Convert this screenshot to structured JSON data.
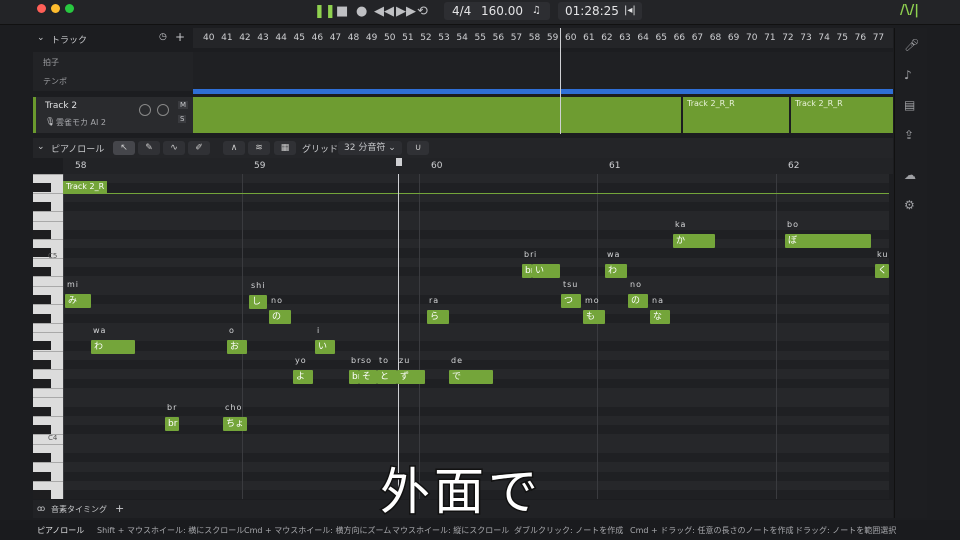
{
  "transport": {
    "time_sig": "4/4",
    "tempo": "160.00",
    "time": "01:28:25"
  },
  "colors": {
    "accent": "#74a53a",
    "clip": "#6e9c31",
    "playhead": "#cfd0d3"
  },
  "tracks_panel": {
    "title": "トラック",
    "rows": [
      "拍子",
      "テンポ"
    ]
  },
  "ruler_top": [
    "40",
    "41",
    "42",
    "43",
    "44",
    "45",
    "46",
    "47",
    "48",
    "49",
    "50",
    "51",
    "52",
    "53",
    "54",
    "55",
    "56",
    "57",
    "58",
    "59",
    "60",
    "61",
    "62",
    "63",
    "64",
    "65",
    "66",
    "67",
    "68",
    "69",
    "70",
    "71",
    "72",
    "73",
    "74",
    "75",
    "76",
    "77"
  ],
  "track2": {
    "name": "Track 2",
    "singer": "雲雀モカ AI 2",
    "mute": "M",
    "solo": "S"
  },
  "clips": [
    "Track 2_R_R",
    "Track 2_R_R"
  ],
  "piano_roll": {
    "title": "ピアノロール",
    "grid_label": "グリッド",
    "grid_value": "32 分音符",
    "bars": [
      "58",
      "59",
      "60",
      "61",
      "62"
    ],
    "clip_label": "Track 2_R",
    "key_c5": "C5",
    "key_c4": "C4"
  },
  "notes": [
    {
      "lyric": "み",
      "roman": "mi"
    },
    {
      "lyric": "わ",
      "roman": "wa"
    },
    {
      "lyric": "ちょ",
      "roman": "cho"
    },
    {
      "lyric": "br",
      "roman": "br"
    },
    {
      "lyric": "お",
      "roman": "o"
    },
    {
      "lyric": "し",
      "roman": "shi"
    },
    {
      "lyric": "の",
      "roman": "no"
    },
    {
      "lyric": "よ",
      "roman": "yo"
    },
    {
      "lyric": "い",
      "roman": "i"
    },
    {
      "lyric": "br",
      "roman": "br"
    },
    {
      "lyric": "そ",
      "roman": "so"
    },
    {
      "lyric": "と",
      "roman": "to"
    },
    {
      "lyric": "ず",
      "roman": "zu"
    },
    {
      "lyric": "ら",
      "roman": "ra"
    },
    {
      "lyric": "で",
      "roman": "de"
    },
    {
      "lyric": "br",
      "roman": "br"
    },
    {
      "lyric": "い",
      "roman": "i"
    },
    {
      "lyric": "つ",
      "roman": "tsu"
    },
    {
      "lyric": "も",
      "roman": "mo"
    },
    {
      "lyric": "わ",
      "roman": "wa"
    },
    {
      "lyric": "の",
      "roman": "no"
    },
    {
      "lyric": "な",
      "roman": "na"
    },
    {
      "lyric": "か",
      "roman": "ka"
    },
    {
      "lyric": "ぼ",
      "roman": "bo"
    },
    {
      "lyric": "く",
      "roman": "ku"
    }
  ],
  "footer_lane": "音素タイミング",
  "status": {
    "mode": "ピアノロール",
    "hints": [
      "Shift + マウスホイール: 横にスクロール",
      "Cmd + マウスホイール: 横方向にズーム",
      "マウスホイール: 縦にスクロール",
      "ダブルクリック: ノートを作成",
      "Cmd + ドラッグ: 任意の長さのノートを作成",
      "ドラッグ: ノートを範囲選択"
    ]
  },
  "subtitle": "外面で"
}
